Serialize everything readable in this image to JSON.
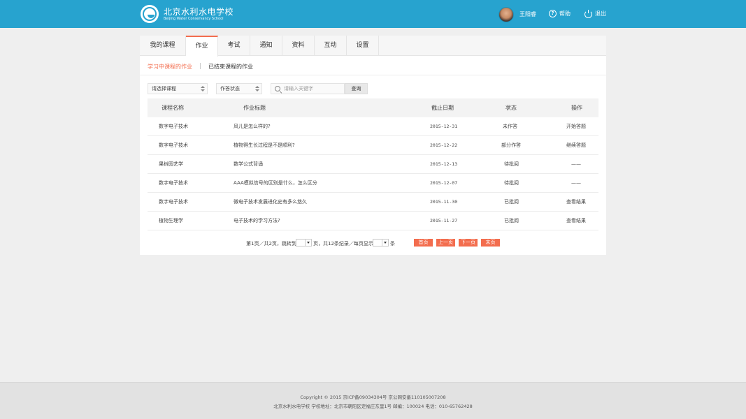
{
  "header": {
    "school_name_cn": "北京水利水电学校",
    "school_name_en": "Beijing Water Conservancy School",
    "username": "王阳睿",
    "help_label": "帮助",
    "logout_label": "退出",
    "help_icon_glyph": "?"
  },
  "tabs": [
    {
      "label": "我的课程"
    },
    {
      "label": "作业"
    },
    {
      "label": "考试"
    },
    {
      "label": "通知"
    },
    {
      "label": "资料"
    },
    {
      "label": "互动"
    },
    {
      "label": "设置"
    }
  ],
  "subtabs": {
    "active": "学习中课程的作业",
    "inactive": "已结束课程的作业"
  },
  "filters": {
    "course_select": "请选择课程",
    "status_select": "作答状态",
    "search_placeholder": "请输入关键字",
    "query_label": "查询"
  },
  "table": {
    "headers": [
      "课程名称",
      "作业标题",
      "截止日期",
      "状态",
      "操作"
    ],
    "rows": [
      {
        "course": "数字电子技术",
        "title": "风儿是怎么样的?",
        "date": "2015-12-31",
        "status": "未作答",
        "action": "开始答题"
      },
      {
        "course": "数字电子技术",
        "title": "植物得生长过程是不是顺利?",
        "date": "2015-12-22",
        "status": "部分作答",
        "action": "继续答题"
      },
      {
        "course": "果树园艺学",
        "title": "数学公式背诵",
        "date": "2015-12-13",
        "status": "待批阅",
        "action": "——"
      },
      {
        "course": "数字电子技术",
        "title": "AAA模拟信号的区别是什么，怎么区分",
        "date": "2015-12-07",
        "status": "待批阅",
        "action": "——"
      },
      {
        "course": "数字电子技术",
        "title": "微电子技术发展进化史有多么悠久",
        "date": "2015-11-30",
        "status": "已批阅",
        "action": "查看结果"
      },
      {
        "course": "植物生理学",
        "title": "电子技术的学习方法?",
        "date": "2015-11-27",
        "status": "已批阅",
        "action": "查看结果"
      }
    ]
  },
  "pager": {
    "text_1": "第1页／共2页，跳转到",
    "text_2": "页，共12条纪录／每页显示",
    "text_3": "条",
    "first": "首页",
    "prev": "上一页",
    "next": "下一页",
    "last": "末页"
  },
  "footer": {
    "line1": "Copyright © 2015    京ICP备09034304号    京公网安备110105007208",
    "line2": "北京水利水电学校    学校地址：北京市朝阳区定福庄东里1号    邮编：100024    电话：010-65762428"
  },
  "colors": {
    "header_bg": "#27a3cf",
    "accent": "#f36d4e"
  }
}
